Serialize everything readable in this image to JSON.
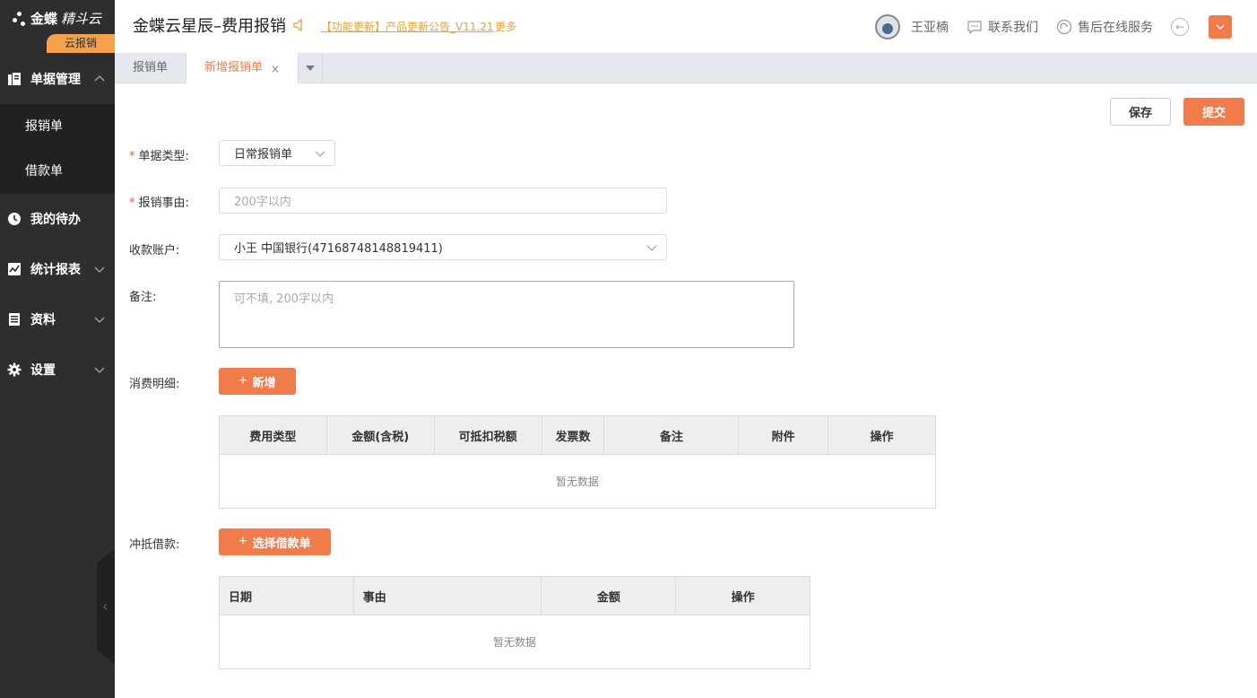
{
  "sidebar": {
    "logo_brand_bold": "金蝶",
    "logo_brand_light": "精斗云",
    "logo_tag": "云报销",
    "groups": [
      {
        "label": "单据管理",
        "icon": "document-icon",
        "expanded": true
      },
      {
        "label": "我的待办",
        "icon": "clock-icon"
      },
      {
        "label": "统计报表",
        "icon": "chart-icon"
      },
      {
        "label": "资料",
        "icon": "book-icon"
      },
      {
        "label": "设置",
        "icon": "gear-icon"
      }
    ],
    "sub_items": [
      "报销单",
      "借款单"
    ],
    "collapse_arrow": "‹"
  },
  "header": {
    "title": "金蝶云星辰–费用报销",
    "announcement": "【功能更新】产品更新公告_V11.21",
    "more": "更多",
    "user_name": "王亚楠",
    "contact": "联系我们",
    "support": "售后在线服务",
    "back_glyph": "←",
    "accent": "#f07c4c"
  },
  "tabs": {
    "items": [
      "报销单",
      "新增报销单"
    ],
    "active_index": 1,
    "close_glyph": "×"
  },
  "form": {
    "save_label": "保存",
    "submit_label": "提交",
    "doc_type_label": "单据类型:",
    "doc_type_value": "日常报销单",
    "reason_label": "报销事由:",
    "reason_placeholder": "200字以内",
    "account_label": "收款账户:",
    "account_value": "小王 中国银行(47168748148819411)",
    "remark_label": "备注:",
    "remark_placeholder": "可不填, 200字以内",
    "detail_label": "消费明细:",
    "add_label": "新增",
    "offset_label": "冲抵借款:",
    "choose_loan_label": "选择借款单"
  },
  "detail_table": {
    "columns": [
      "费用类型",
      "金额(含税)",
      "可抵扣税额",
      "发票数",
      "备注",
      "附件",
      "操作"
    ],
    "empty_text": "暂无数据"
  },
  "loan_table": {
    "columns": [
      "日期",
      "事由",
      "金额",
      "操作"
    ],
    "empty_text": "暂无数据"
  }
}
